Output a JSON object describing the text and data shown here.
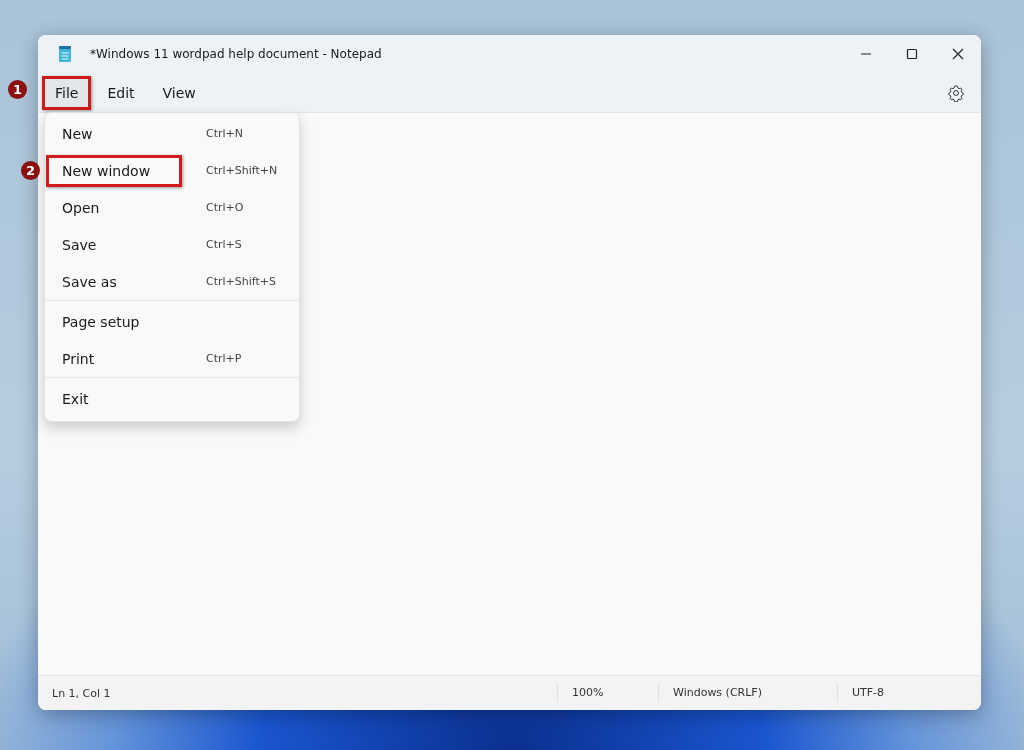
{
  "window": {
    "title": "*Windows 11 wordpad help document - Notepad"
  },
  "menu_bar": [
    {
      "label": "File",
      "selected": true,
      "callout": "1"
    },
    {
      "label": "Edit",
      "selected": false
    },
    {
      "label": "View",
      "selected": false
    }
  ],
  "file_menu": {
    "sections": [
      [
        {
          "label": "New",
          "shortcut": "Ctrl+N"
        },
        {
          "label": "New window",
          "shortcut": "Ctrl+Shift+N",
          "callout": "2"
        },
        {
          "label": "Open",
          "shortcut": "Ctrl+O"
        },
        {
          "label": "Save",
          "shortcut": "Ctrl+S"
        },
        {
          "label": "Save as",
          "shortcut": "Ctrl+Shift+S"
        }
      ],
      [
        {
          "label": "Page setup"
        },
        {
          "label": "Print",
          "shortcut": "Ctrl+P"
        }
      ],
      [
        {
          "label": "Exit"
        }
      ]
    ]
  },
  "status_bar": {
    "position": "Ln 1, Col 1",
    "zoom": "100%",
    "line_ending": "Windows (CRLF)",
    "encoding": "UTF-8"
  }
}
